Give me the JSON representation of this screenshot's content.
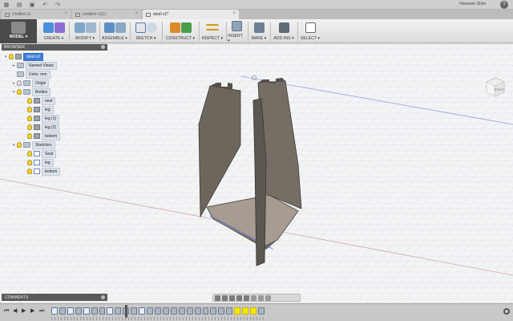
{
  "app": {
    "user_name": "Heeseon Shim",
    "help_label": "?"
  },
  "tabs": [
    {
      "label": "Untitled v1"
    },
    {
      "label": "Untitled v1(1)"
    },
    {
      "label": "stool v1*"
    }
  ],
  "toolbar": {
    "workspace": "MODEL ▾",
    "groups": [
      {
        "label": "CREATE ▾"
      },
      {
        "label": "MODIFY ▾"
      },
      {
        "label": "ASSEMBLE ▾"
      },
      {
        "label": "SKETCH ▾"
      },
      {
        "label": "CONSTRUCT ▾"
      },
      {
        "label": "INSPECT ▾"
      },
      {
        "label": "INSERT ▾"
      },
      {
        "label": "MAKE ▾"
      },
      {
        "label": "ADD-INS ▾"
      },
      {
        "label": "SELECT ▾"
      }
    ]
  },
  "browser": {
    "title": "BROWSER",
    "items": [
      {
        "label": "stool v1"
      },
      {
        "label": "Named Views"
      },
      {
        "label": "Units: mm"
      },
      {
        "label": "Origin"
      },
      {
        "label": "Bodies"
      },
      {
        "label": "seat"
      },
      {
        "label": "leg"
      },
      {
        "label": "leg (1)"
      },
      {
        "label": "leg (2)"
      },
      {
        "label": "bottom"
      },
      {
        "label": "Sketches"
      },
      {
        "label": "Seat"
      },
      {
        "label": "leg"
      },
      {
        "label": "bottom"
      }
    ]
  },
  "viewcube": {
    "face_label": "RIGHT"
  },
  "comments": {
    "title": "COMMENTS"
  },
  "colors": {
    "accent": "#3d7fd6",
    "body_fill": "#6c665d",
    "bottom_fill": "#a79c92",
    "timeline_highlight": "#f5e800"
  }
}
